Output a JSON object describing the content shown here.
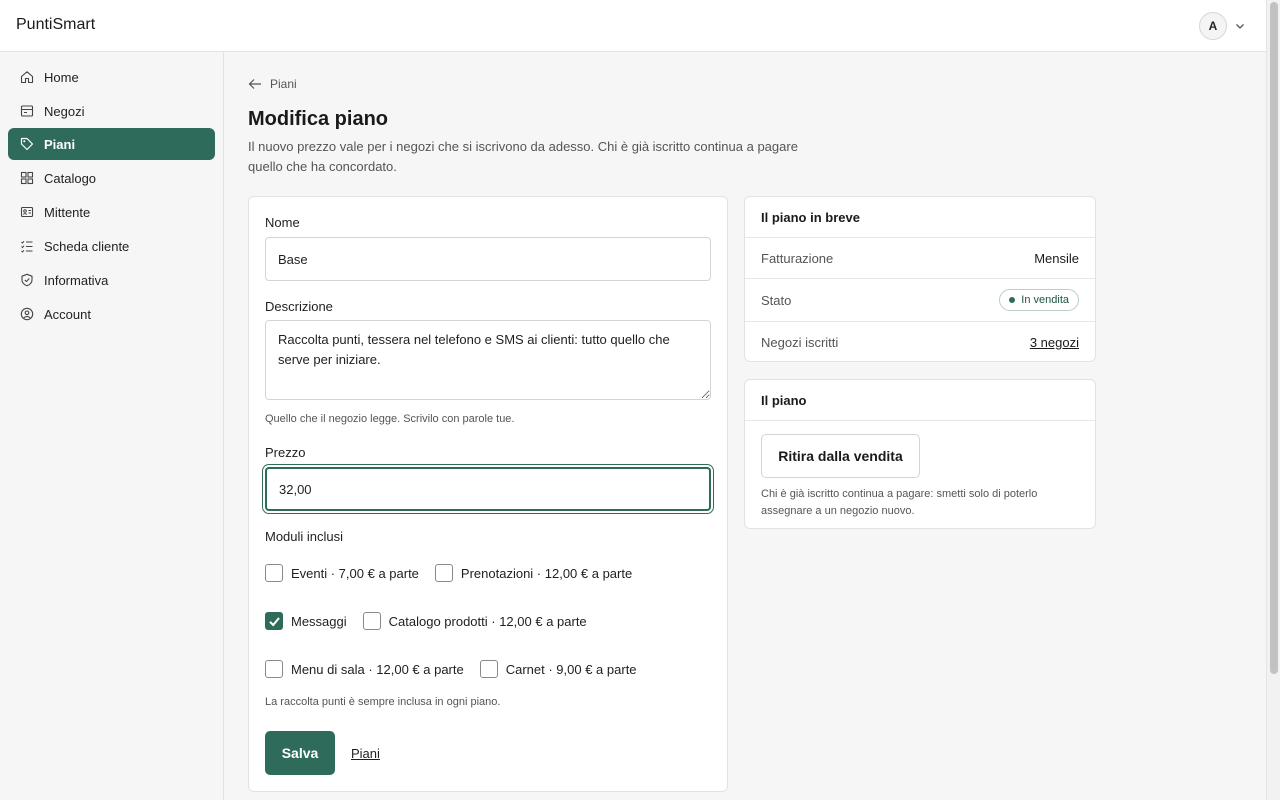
{
  "app": {
    "brand": "PuntiSmart",
    "user_initial": "A"
  },
  "sidebar": {
    "items": [
      {
        "label": "Home",
        "icon": "home-icon"
      },
      {
        "label": "Negozi",
        "icon": "store-icon"
      },
      {
        "label": "Piani",
        "icon": "tag-icon",
        "active": true
      },
      {
        "label": "Catalogo",
        "icon": "grid-icon"
      },
      {
        "label": "Mittente",
        "icon": "id-card-icon"
      },
      {
        "label": "Scheda cliente",
        "icon": "checklist-icon"
      },
      {
        "label": "Informativa",
        "icon": "shield-check-icon"
      },
      {
        "label": "Account",
        "icon": "user-circle-icon"
      }
    ]
  },
  "breadcrumb": {
    "label": "Piani"
  },
  "page": {
    "title": "Modifica piano",
    "description": "Il nuovo prezzo vale per i negozi che si iscrivono da adesso. Chi è già iscritto continua a pagare quello che ha concordato."
  },
  "form": {
    "name_label": "Nome",
    "name_value": "Base",
    "description_label": "Descrizione",
    "description_value": "Raccolta punti, tessera nel telefono e SMS ai clienti: tutto quello che serve per iniziare.",
    "description_help": "Quello che il negozio legge. Scrivilo con parole tue.",
    "price_label": "Prezzo",
    "price_value": "32,00",
    "modules_label": "Moduli inclusi",
    "modules": [
      {
        "label": "Eventi · 7,00 € a parte",
        "checked": false
      },
      {
        "label": "Prenotazioni · 12,00 € a parte",
        "checked": false
      },
      {
        "label": "Messaggi",
        "checked": true
      },
      {
        "label": "Catalogo prodotti · 12,00 € a parte",
        "checked": false
      },
      {
        "label": "Menu di sala · 12,00 € a parte",
        "checked": false
      },
      {
        "label": "Carnet · 9,00 € a parte",
        "checked": false
      }
    ],
    "modules_help": "La raccolta punti è sempre inclusa in ogni piano.",
    "save_label": "Salva",
    "cancel_label": "Piani"
  },
  "summary": {
    "title": "Il piano in breve",
    "billing_label": "Fatturazione",
    "billing_value": "Mensile",
    "status_label": "Stato",
    "status_value": "In vendita",
    "stores_label": "Negozi iscritti",
    "stores_value": "3 negozi"
  },
  "plan": {
    "title": "Il piano",
    "withdraw_label": "Ritira dalla vendita",
    "withdraw_help": "Chi è già iscritto continua a pagare: smetti solo di poterlo assegnare a un negozio nuovo."
  },
  "colors": {
    "accent": "#2e6b5b",
    "background": "#f6f6f6",
    "card": "#ffffff",
    "border": "#e2e2e2"
  }
}
